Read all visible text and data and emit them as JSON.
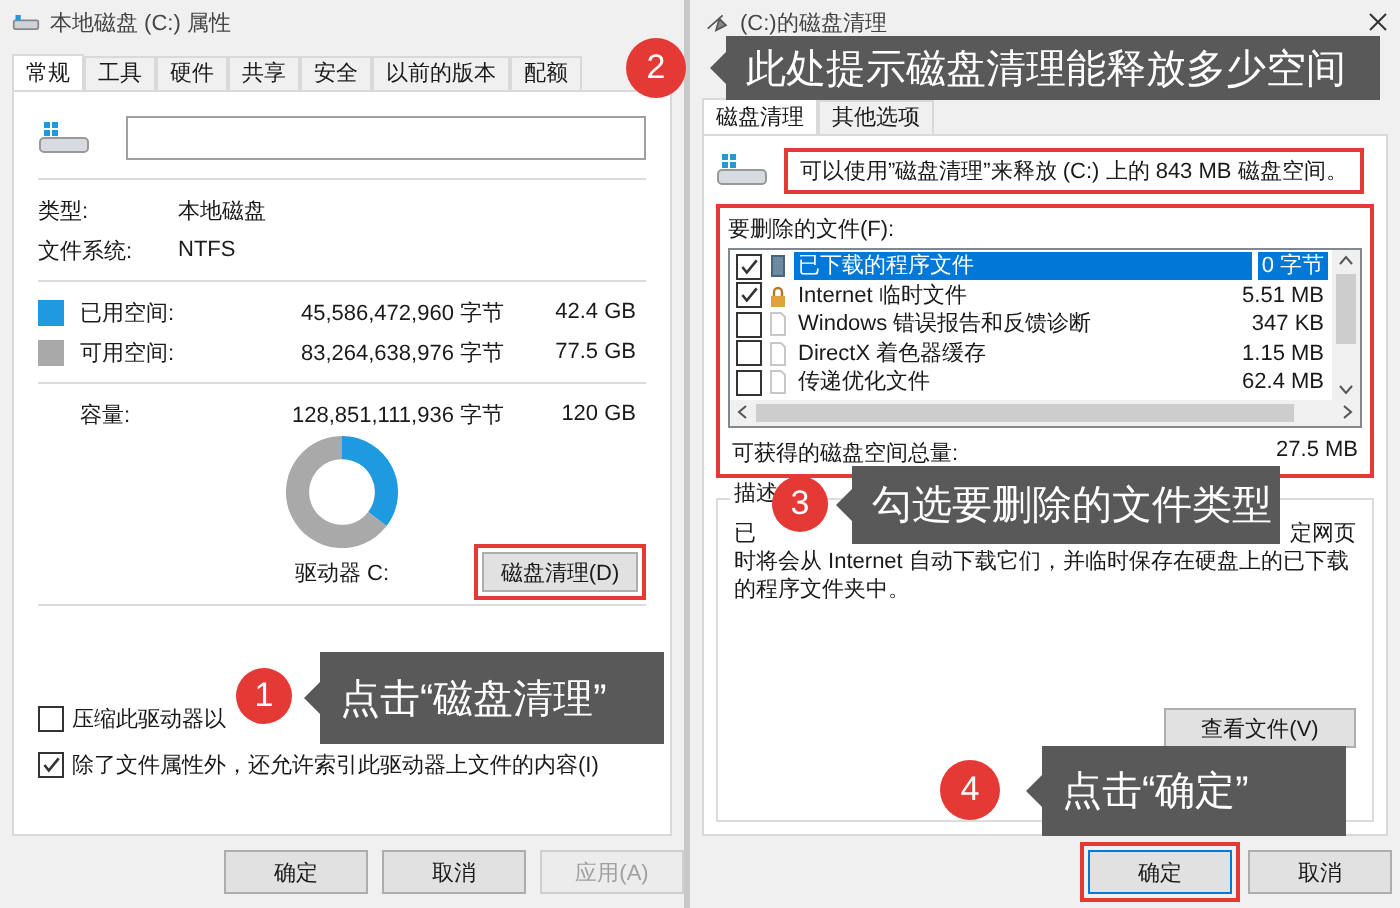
{
  "left_window": {
    "title": "本地磁盘 (C:) 属性",
    "tabs": [
      {
        "label": "常规",
        "selected": true
      },
      {
        "label": "工具",
        "selected": false
      },
      {
        "label": "硬件",
        "selected": false
      },
      {
        "label": "共享",
        "selected": false
      },
      {
        "label": "安全",
        "selected": false
      },
      {
        "label": "以前的版本",
        "selected": false
      },
      {
        "label": "配额",
        "selected": false
      }
    ],
    "properties": [
      {
        "label": "类型:",
        "value": "本地磁盘"
      },
      {
        "label": "文件系统:",
        "value": "NTFS"
      }
    ],
    "space": [
      {
        "label": "已用空间:",
        "bytes": "45,586,472,960 字节",
        "size": "42.4 GB",
        "color": "#1e9be0"
      },
      {
        "label": "可用空间:",
        "bytes": "83,264,638,976 字节",
        "size": "77.5 GB",
        "color": "#a9a9a9"
      }
    ],
    "capacity": {
      "label": "容量:",
      "bytes": "128,851,111,936 字节",
      "size": "120 GB"
    },
    "usage_chart": {
      "chart_data": {
        "type": "donut",
        "values": [
          35.4,
          64.6
        ]
      }
    },
    "drive_label": "驱动器 C:",
    "cleanup_button": {
      "label": "磁盘清理(D)",
      "highlighted": true
    },
    "options": [
      {
        "label": "压缩此驱动器以",
        "checked": false
      },
      {
        "label": "除了文件属性外，还允许索引此驱动器上文件的内容(I)",
        "checked": true
      }
    ],
    "buttons": [
      {
        "label": "确定",
        "disabled": false
      },
      {
        "label": "取消",
        "disabled": false
      },
      {
        "label": "应用(A)",
        "disabled": true
      }
    ]
  },
  "right_window": {
    "title": "(C:)的磁盘清理",
    "tabs": [
      {
        "label": "磁盘清理",
        "selected": true
      },
      {
        "label": "其他选项",
        "selected": false
      }
    ],
    "summary": {
      "text": "可以使用”磁盘清理”来释放 (C:) 上的 843 MB 磁盘空间。",
      "highlighted": true
    },
    "files_to_delete": {
      "label": "要删除的文件(F):",
      "highlighted": true,
      "items": [
        {
          "kind": "package",
          "name": "已下载的程序文件",
          "size": "0 字节",
          "checked": true,
          "selected": true
        },
        {
          "kind": "lock",
          "name": "Internet 临时文件",
          "size": "5.51 MB",
          "checked": true,
          "selected": false
        },
        {
          "kind": "document",
          "name": "Windows 错误报告和反馈诊断",
          "size": "347 KB",
          "checked": false,
          "selected": false
        },
        {
          "kind": "document",
          "name": "DirectX 着色器缓存",
          "size": "1.15 MB",
          "checked": false,
          "selected": false
        },
        {
          "kind": "document",
          "name": "传递优化文件",
          "size": "62.4 MB",
          "checked": false,
          "selected": false
        }
      ],
      "total_label": "可获得的磁盘空间总量:",
      "total": "27.5 MB"
    },
    "description": {
      "legend": "描述",
      "visible_start": "已",
      "visible_end": "定网页",
      "text": "时将会从 Internet 自动下载它们，并临时保存在硬盘上的已下载的程序文件夹中。"
    },
    "view_files_button": "查看文件(V)",
    "buttons": [
      {
        "label": "确定",
        "highlighted": true
      },
      {
        "label": "取消",
        "highlighted": false
      }
    ]
  },
  "callouts": [
    {
      "number": "1",
      "text": "点击“磁盘清理”"
    },
    {
      "number": "2",
      "text": "此处提示磁盘清理能释放多少空间"
    },
    {
      "number": "3",
      "text": "勾选要删除的文件类型"
    },
    {
      "number": "4",
      "text": "点击“确定”"
    }
  ]
}
